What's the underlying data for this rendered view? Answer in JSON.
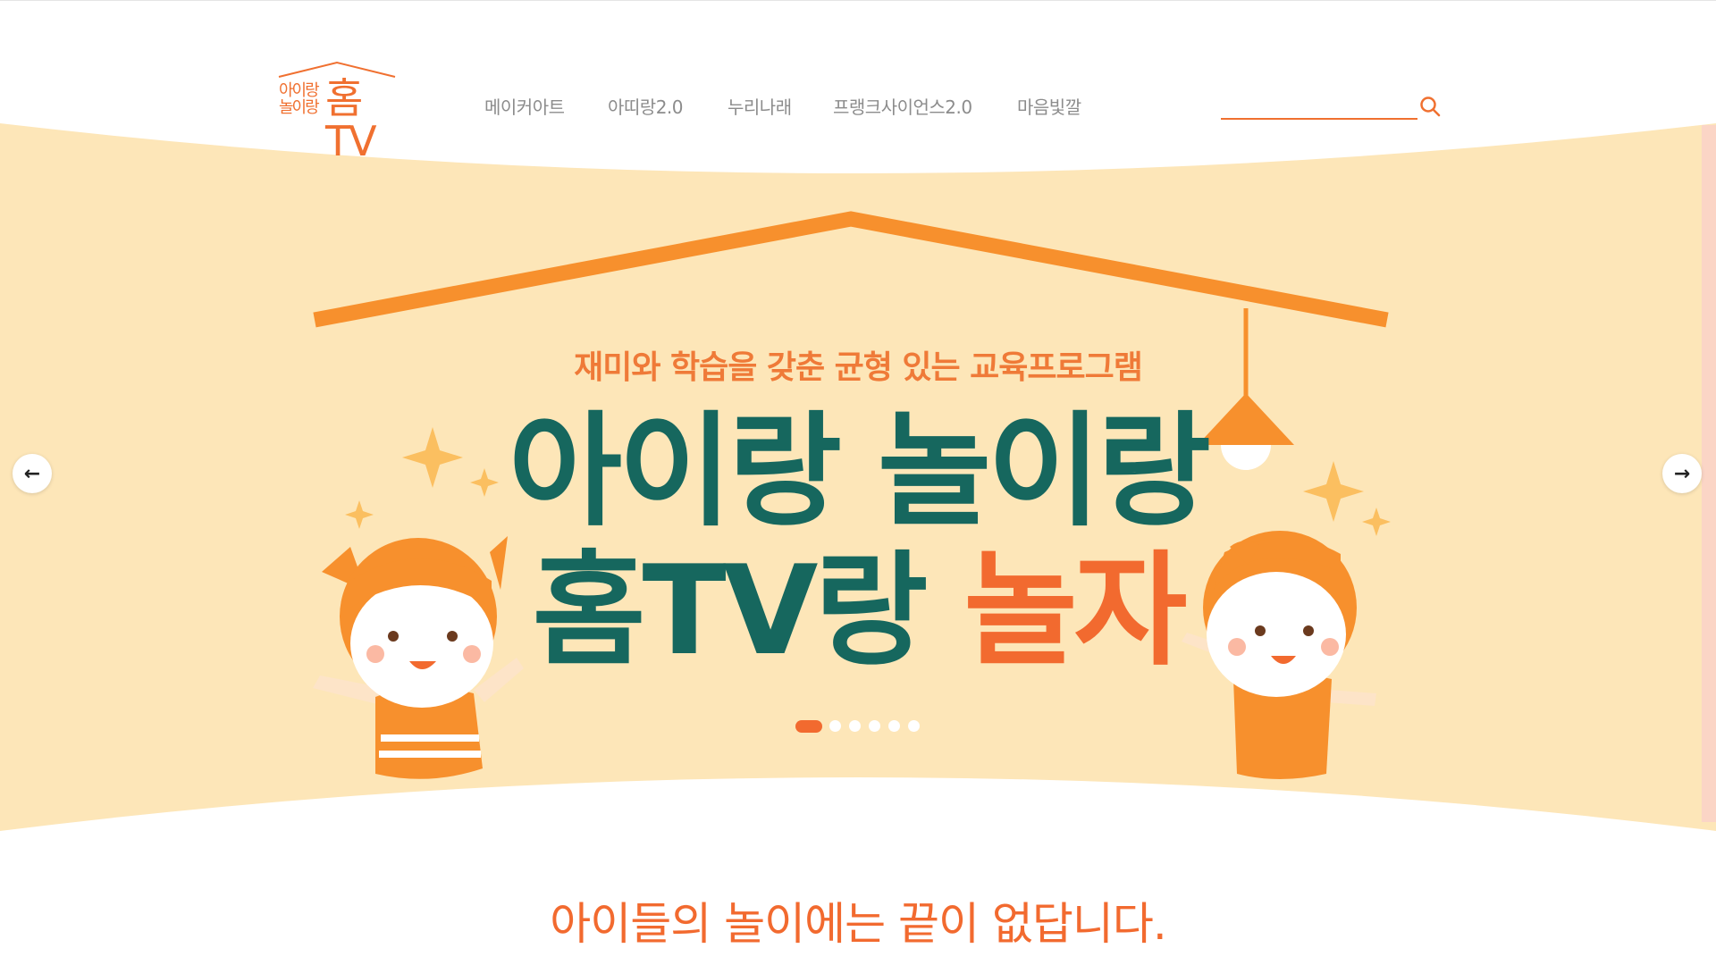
{
  "header": {
    "logo": {
      "small_line1": "아이랑",
      "small_line2": "놀이랑",
      "big": "홈TV"
    },
    "nav": [
      {
        "label": "메이커아트"
      },
      {
        "label": "아띠랑2.0"
      },
      {
        "label": "누리나래"
      },
      {
        "label": "프랭크사이언스2.0"
      },
      {
        "label": "마음빛깔"
      }
    ],
    "search": {
      "value": "",
      "placeholder": ""
    }
  },
  "hero": {
    "subtitle": "재미와 학습을 갖춘 균형 있는 교육프로그램",
    "title_line1": "아이랑 놀이랑",
    "title_line2_main": "홈TV랑",
    "title_line2_accent": "놀자",
    "prev_arrow": "←",
    "next_arrow": "→",
    "slides_total": 6,
    "active_slide": 1
  },
  "tagline": "아이들의 놀이에는 끝이 없답니다.",
  "colors": {
    "brand_orange": "#f26a2f",
    "hero_background": "#fde6b8",
    "title_teal": "#16675e",
    "nav_gray": "#8c8c8c"
  },
  "icons": [
    "search-icon",
    "arrow-left-icon",
    "arrow-right-icon",
    "sparkle-icon",
    "lamp-icon",
    "house-roof-icon"
  ]
}
